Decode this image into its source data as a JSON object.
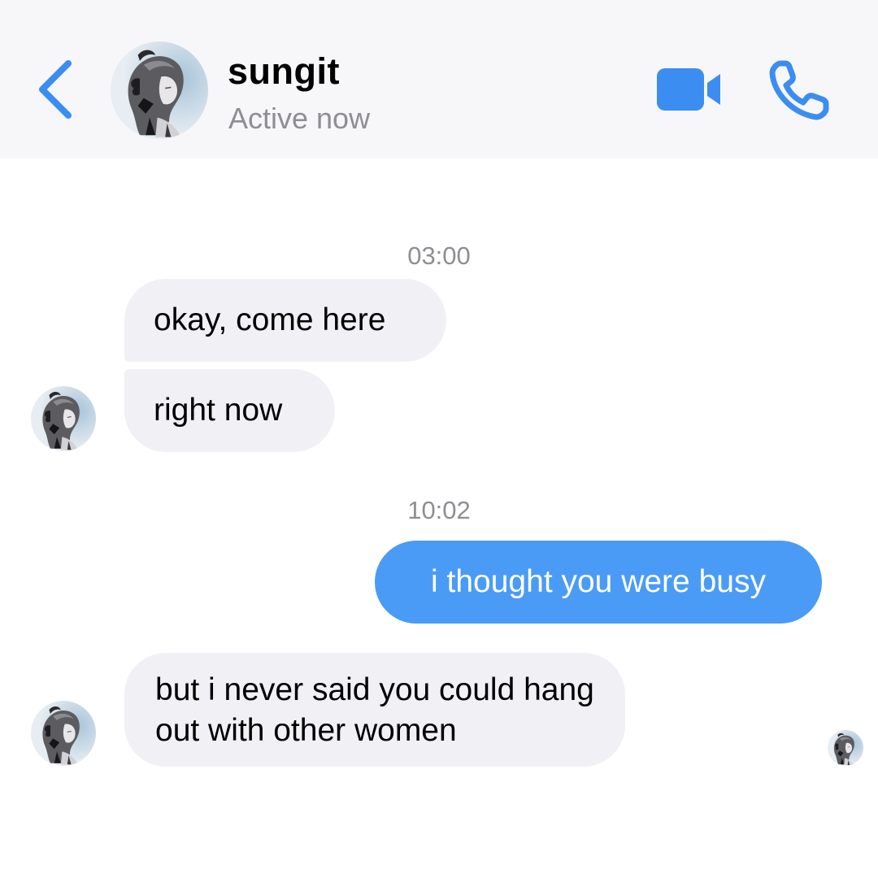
{
  "header": {
    "contact_name": "sungit",
    "status": "Active now",
    "accent_color": "#3b8df1",
    "icons": {
      "back": "chevron-left-icon",
      "video": "video-camera-icon",
      "phone": "phone-icon"
    }
  },
  "messages": [
    {
      "timestamp": "03:00"
    },
    {
      "sender": "contact",
      "text": "okay, come here"
    },
    {
      "sender": "contact",
      "text": "right now"
    },
    {
      "timestamp": "10:02"
    },
    {
      "sender": "me",
      "text": "i thought you were busy"
    },
    {
      "sender": "contact",
      "text": "but i never said you could hang out with other women"
    }
  ],
  "colors": {
    "incoming_bubble": "#f1f1f5",
    "outgoing_bubble": "#4a9bf5",
    "header_background": "#f7f7f9",
    "secondary_text": "#8e8e93"
  }
}
